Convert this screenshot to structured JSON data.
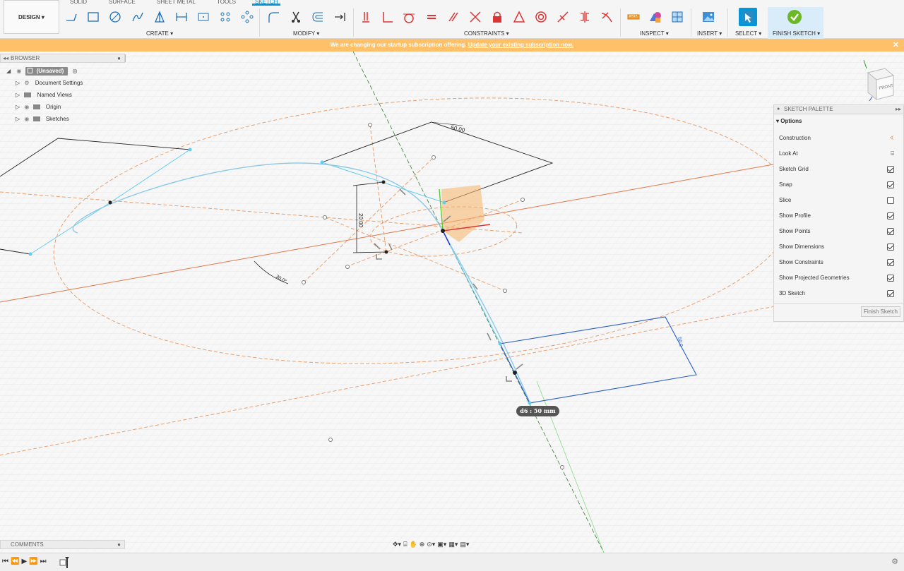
{
  "toolbar": {
    "workspace_label": "DESIGN",
    "tabs": [
      "SOLID",
      "SURFACE",
      "SHEET METAL",
      "TOOLS",
      "SKETCH"
    ],
    "groups": {
      "create": "CREATE",
      "modify": "MODIFY",
      "constraints": "CONSTRAINTS",
      "inspect": "INSPECT",
      "insert": "INSERT",
      "select": "SELECT",
      "finish": "FINISH SKETCH"
    }
  },
  "banner": {
    "message": "We are changing our startup subscription offering.",
    "link": "Update your existing subscription now.",
    "close": "✕"
  },
  "browser": {
    "title": "BROWSER",
    "root": "(Unsaved)",
    "items": [
      "Document Settings",
      "Named Views",
      "Origin",
      "Sketches"
    ]
  },
  "palette": {
    "title": "SKETCH PALETTE",
    "section": "Options",
    "rows": [
      {
        "label": "Construction",
        "type": "icon"
      },
      {
        "label": "Look At",
        "type": "icon"
      },
      {
        "label": "Sketch Grid",
        "checked": true
      },
      {
        "label": "Snap",
        "checked": true
      },
      {
        "label": "Slice",
        "checked": false
      },
      {
        "label": "Show Profile",
        "checked": true
      },
      {
        "label": "Show Points",
        "checked": true
      },
      {
        "label": "Show Dimensions",
        "checked": true
      },
      {
        "label": "Show Constraints",
        "checked": true
      },
      {
        "label": "Show Projected Geometries",
        "checked": true
      },
      {
        "label": "3D Sketch",
        "checked": true
      }
    ],
    "finish_button": "Finish Sketch"
  },
  "canvas": {
    "dimensions": [
      "50.00",
      "20.00",
      "30.0°",
      "50.0"
    ],
    "tooltip": "d6 : 50 mm",
    "viewcube_label": "FRONT"
  },
  "comments": {
    "title": "COMMENTS"
  },
  "colors": {
    "accent": "#0696d7",
    "banner": "#fec16a",
    "construction": "#e8a070",
    "sketch": "#66ccee"
  }
}
